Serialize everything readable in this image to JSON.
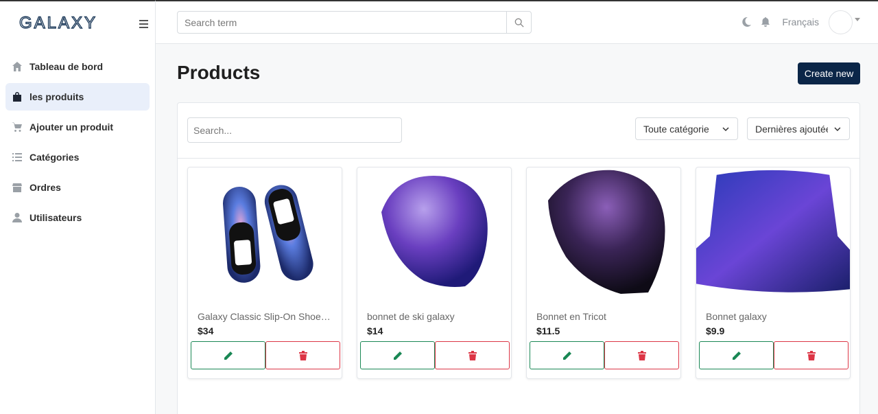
{
  "brand": {
    "logo_text": "GALAXY"
  },
  "sidebar": {
    "items": [
      {
        "label": "Tableau de bord",
        "icon": "home-icon",
        "active": false
      },
      {
        "label": "les produits",
        "icon": "shopping-bag-icon",
        "active": true
      },
      {
        "label": "Ajouter un produit",
        "icon": "cart-plus-icon",
        "active": false
      },
      {
        "label": "Catégories",
        "icon": "list-icon",
        "active": false
      },
      {
        "label": "Ordres",
        "icon": "store-icon",
        "active": false
      },
      {
        "label": "Utilisateurs",
        "icon": "user-icon",
        "active": false
      }
    ]
  },
  "header": {
    "search_placeholder": "Search term",
    "language": "Français"
  },
  "page": {
    "title": "Products",
    "create_label": "Create new"
  },
  "filters": {
    "search_placeholder": "Search...",
    "category_value": "Toute catégorie",
    "sort_value": "Dernières ajoutée"
  },
  "products": [
    {
      "name": "Galaxy Classic Slip-On Shoes (Customized)",
      "price": "$34"
    },
    {
      "name": "bonnet de ski galaxy",
      "price": "$14"
    },
    {
      "name": "Bonnet en Tricot",
      "price": "$11.5"
    },
    {
      "name": "Bonnet galaxy",
      "price": "$9.9"
    }
  ],
  "colors": {
    "primary": "#0b2648",
    "edit": "#198754",
    "delete": "#dc3545",
    "active_bg": "#e9effa"
  }
}
